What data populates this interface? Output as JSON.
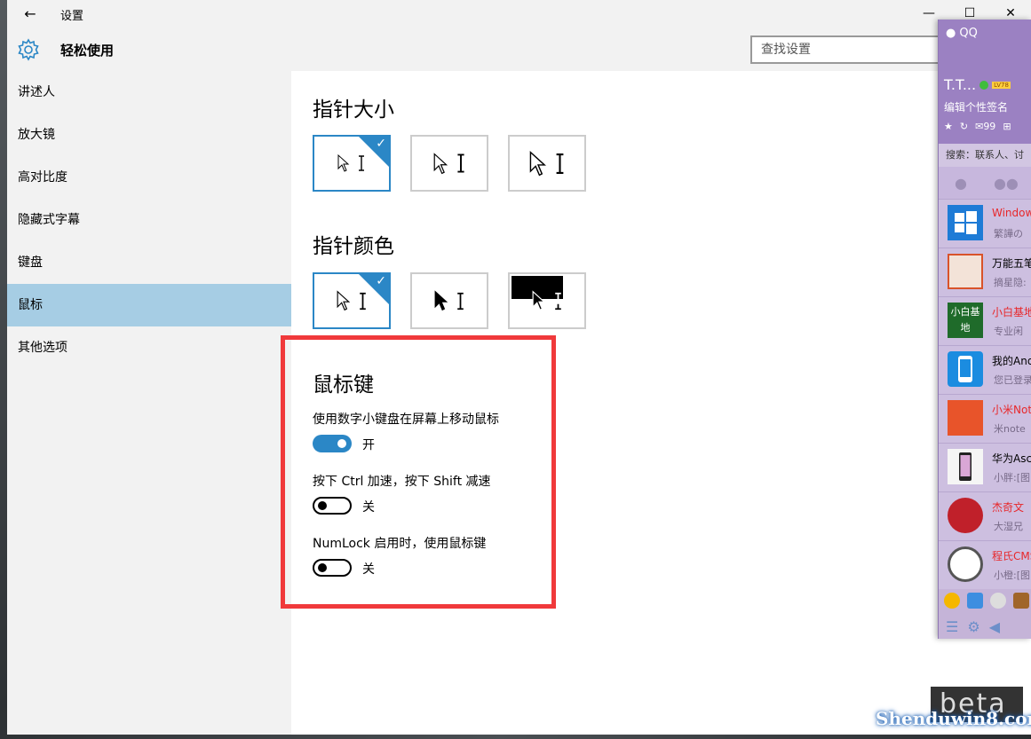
{
  "window": {
    "back_glyph": "←",
    "title": "设置",
    "minimize_glyph": "—",
    "maximize_glyph": "☐",
    "close_glyph": "✕"
  },
  "header": {
    "section_title": "轻松使用",
    "search_placeholder": "查找设置"
  },
  "sidebar": {
    "items": [
      {
        "label": "讲述人"
      },
      {
        "label": "放大镜"
      },
      {
        "label": "高对比度"
      },
      {
        "label": "隐藏式字幕"
      },
      {
        "label": "键盘"
      },
      {
        "label": "鼠标"
      },
      {
        "label": "其他选项"
      }
    ],
    "active_index": 5
  },
  "pointer_size": {
    "title": "指针大小",
    "selected_index": 0
  },
  "pointer_color": {
    "title": "指针颜色",
    "selected_index": 0
  },
  "mouse_keys": {
    "title": "鼠标键",
    "settings": [
      {
        "label": "使用数字小键盘在屏幕上移动鼠标",
        "state": "开",
        "on": true
      },
      {
        "label": "按下 Ctrl 加速，按下 Shift 减速",
        "state": "关",
        "on": false
      },
      {
        "label": "NumLock 启用时，使用鼠标键",
        "state": "关",
        "on": false
      }
    ],
    "highlight_color": "#f0393b"
  },
  "qq": {
    "app_name": "QQ",
    "nickname": "T.T...",
    "level": "LV78",
    "signature": "编辑个性签名",
    "mail_count": "99",
    "search_placeholder": "搜索：联系人、讨",
    "contacts": [
      {
        "name": "Window",
        "sig": "繁譁の",
        "name_color": "#e8272a"
      },
      {
        "name": "万能五笔",
        "sig": "摘星隐:",
        "name_color": "#000000"
      },
      {
        "name": "小白基地",
        "sig": "专业闲",
        "name_color": "#e8272a"
      },
      {
        "name": "我的Andr",
        "sig": "您已登录",
        "name_color": "#000000"
      },
      {
        "name": "小米Note",
        "sig": "米note",
        "name_color": "#e8272a"
      },
      {
        "name": "华为Asc",
        "sig": "小胖:[图",
        "name_color": "#000000"
      },
      {
        "name": "杰奇文",
        "sig": "大湿兄",
        "name_color": "#e8272a"
      },
      {
        "name": "程氏CMS",
        "sig": "小橙:[图",
        "name_color": "#e8272a"
      }
    ],
    "avatar_xiaobai_text": "小白基地",
    "header_color": "#9b81c2"
  },
  "watermark": {
    "text": "Shenduwin8.com",
    "beta": "beta"
  },
  "accent_color": "#2b87c6"
}
